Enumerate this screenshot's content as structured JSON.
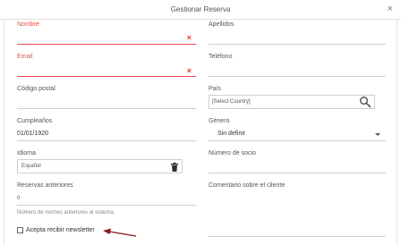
{
  "dialog": {
    "title": "Gestionar Reserva",
    "close_symbol": "×"
  },
  "fields": {
    "nombre": {
      "label": "Nombre",
      "value": "",
      "error_icon": "×"
    },
    "apellidos": {
      "label": "Apellidos",
      "value": ""
    },
    "email": {
      "label": "Email",
      "value": "",
      "error_icon": "×"
    },
    "telefono": {
      "label": "Teléfono",
      "value": ""
    },
    "codigo_postal": {
      "label": "Código postal",
      "value": ""
    },
    "pais": {
      "label": "País",
      "placeholder": "[Select Country]",
      "icon": "search-icon"
    },
    "cumpleanos": {
      "label": "Cumpleaños",
      "value": "01/01/1920"
    },
    "genero": {
      "label": "Género",
      "selected": "Sin definir"
    },
    "idioma": {
      "label": "Idioma",
      "value": "Español",
      "icon": "trash-icon"
    },
    "numero_socio": {
      "label": "Número de socio",
      "value": ""
    },
    "reservas_anteriores": {
      "label": "Reservas anteriores",
      "value": "0",
      "hint": "Número de noches anteriores al sistema."
    },
    "comentario": {
      "label": "Comentario sobre el cliente",
      "value": ""
    },
    "newsletter": {
      "label": "Acepta recibir newsletter",
      "checked": false
    }
  },
  "colors": {
    "error": "#e84a4a",
    "border": "#cfcfcf",
    "arrow": "#8b1a1a"
  }
}
